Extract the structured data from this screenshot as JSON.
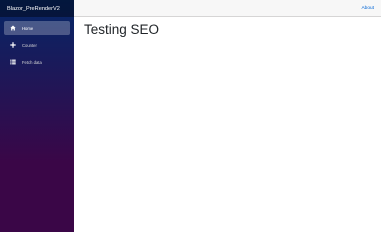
{
  "app": {
    "brand": "Blazor_PreRenderV2"
  },
  "sidebar": {
    "items": [
      {
        "label": "Home",
        "icon": "home-icon",
        "active": true
      },
      {
        "label": "Counter",
        "icon": "plus-icon",
        "active": false
      },
      {
        "label": "Fetch data",
        "icon": "list-icon",
        "active": false
      }
    ]
  },
  "topbar": {
    "about_label": "About"
  },
  "main": {
    "title": "Testing SEO"
  },
  "colors": {
    "sidebar_top": "#052767",
    "sidebar_bottom": "#3a0647",
    "link": "#0366d6",
    "topbar_bg": "#f7f7f7"
  }
}
